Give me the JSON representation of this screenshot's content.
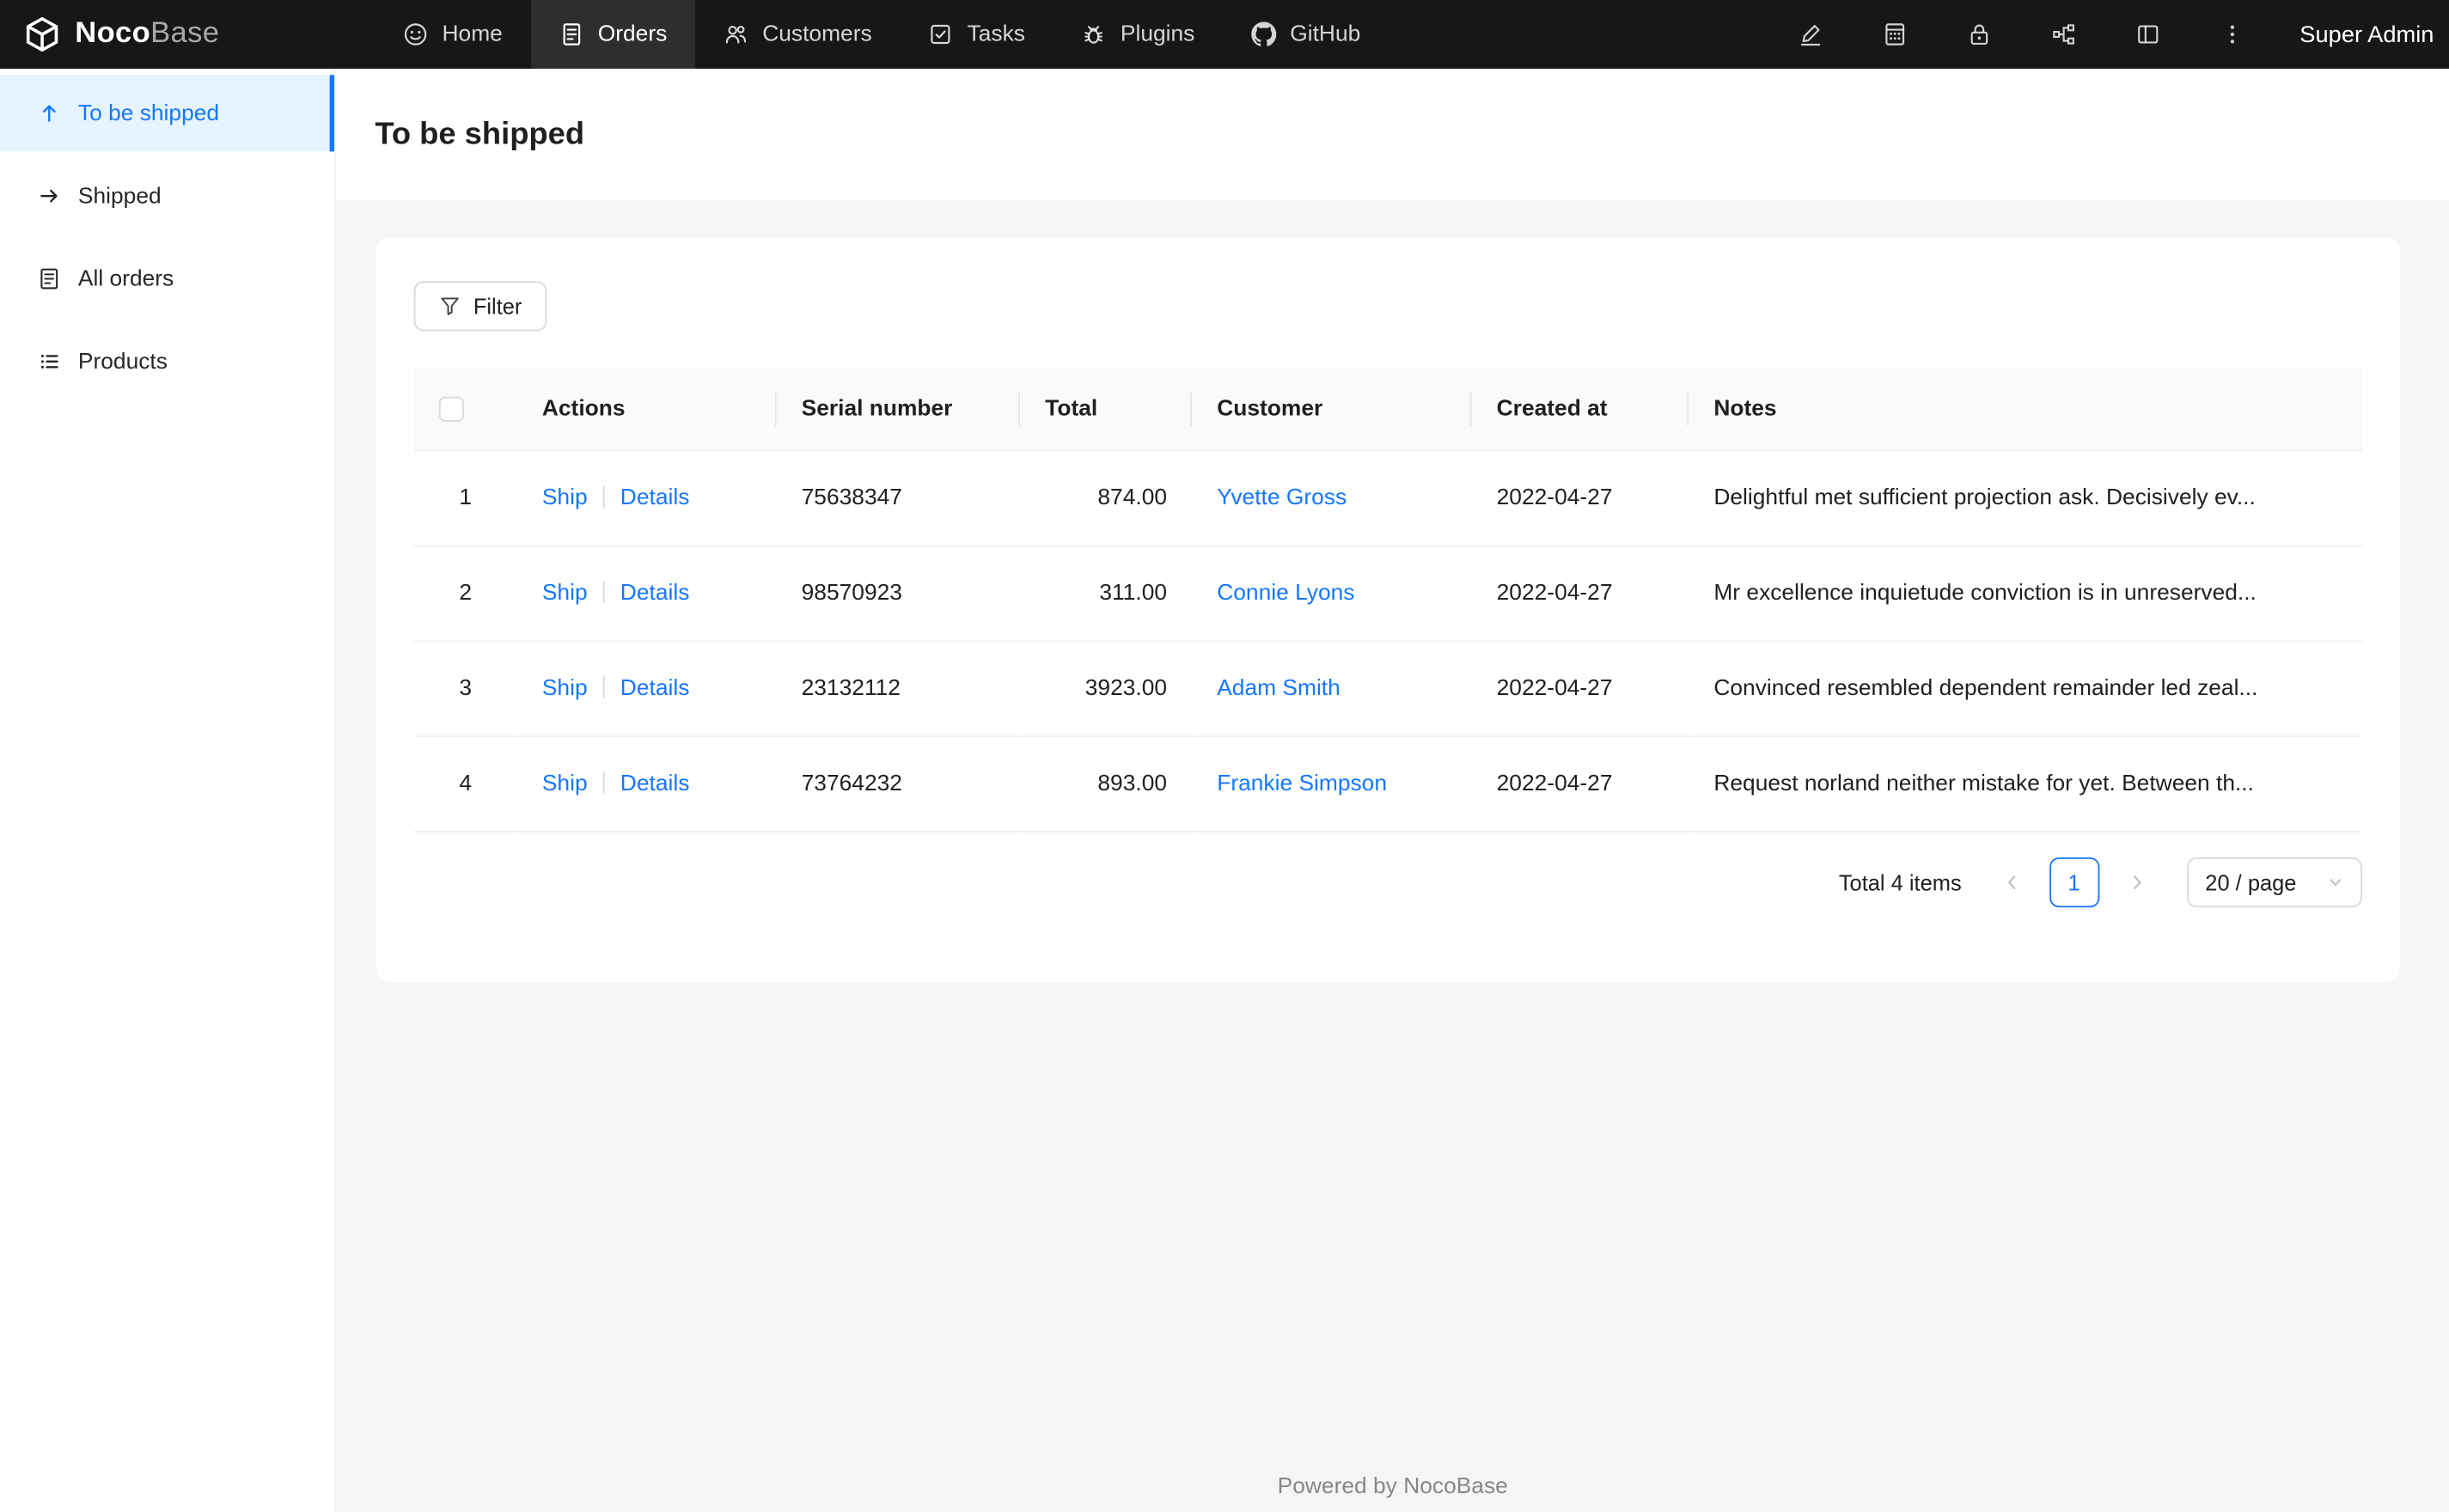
{
  "colors": {
    "accent": "#1677ff",
    "navbar_bg": "#171717",
    "sidebar_active_bg": "#e6f4ff",
    "link": "#1677ff"
  },
  "navbar": {
    "logo": {
      "brand_bold": "Noco",
      "brand_light": "Base"
    },
    "items": [
      {
        "label": "Home"
      },
      {
        "label": "Orders"
      },
      {
        "label": "Customers"
      },
      {
        "label": "Tasks"
      },
      {
        "label": "Plugins"
      },
      {
        "label": "GitHub"
      }
    ],
    "active_item": "Orders",
    "right_icons": [
      "highlighter-icon",
      "calculator-icon",
      "lock-icon",
      "api-icon",
      "layout-icon",
      "more-icon"
    ],
    "user": "Super Admin"
  },
  "sidebar": {
    "items": [
      {
        "label": "To be shipped"
      },
      {
        "label": "Shipped"
      },
      {
        "label": "All orders"
      },
      {
        "label": "Products"
      }
    ],
    "active_item": "To be shipped"
  },
  "page": {
    "title": "To be shipped"
  },
  "toolbar": {
    "filter_label": "Filter"
  },
  "table": {
    "columns": [
      "Actions",
      "Serial number",
      "Total",
      "Customer",
      "Created at",
      "Notes"
    ],
    "rows": [
      {
        "index": "1",
        "actions": [
          "Ship",
          "Details"
        ],
        "serial": "75638347",
        "total": "874.00",
        "customer": "Yvette Gross",
        "created_at": "2022-04-27",
        "notes": "Delightful met sufficient projection ask. Decisively ev..."
      },
      {
        "index": "2",
        "actions": [
          "Ship",
          "Details"
        ],
        "serial": "98570923",
        "total": "311.00",
        "customer": "Connie Lyons",
        "created_at": "2022-04-27",
        "notes": "Mr excellence inquietude conviction is in unreserved..."
      },
      {
        "index": "3",
        "actions": [
          "Ship",
          "Details"
        ],
        "serial": "23132112",
        "total": "3923.00",
        "customer": "Adam Smith",
        "created_at": "2022-04-27",
        "notes": "Convinced resembled dependent remainder led zeal..."
      },
      {
        "index": "4",
        "actions": [
          "Ship",
          "Details"
        ],
        "serial": "73764232",
        "total": "893.00",
        "customer": "Frankie Simpson",
        "created_at": "2022-04-27",
        "notes": "Request norland neither mistake for yet. Between th..."
      }
    ]
  },
  "pagination": {
    "total_text": "Total 4 items",
    "current_page": "1",
    "page_size": "20 / page"
  },
  "footer": {
    "prefix": "Powered by",
    "link_text": "NocoBase"
  }
}
